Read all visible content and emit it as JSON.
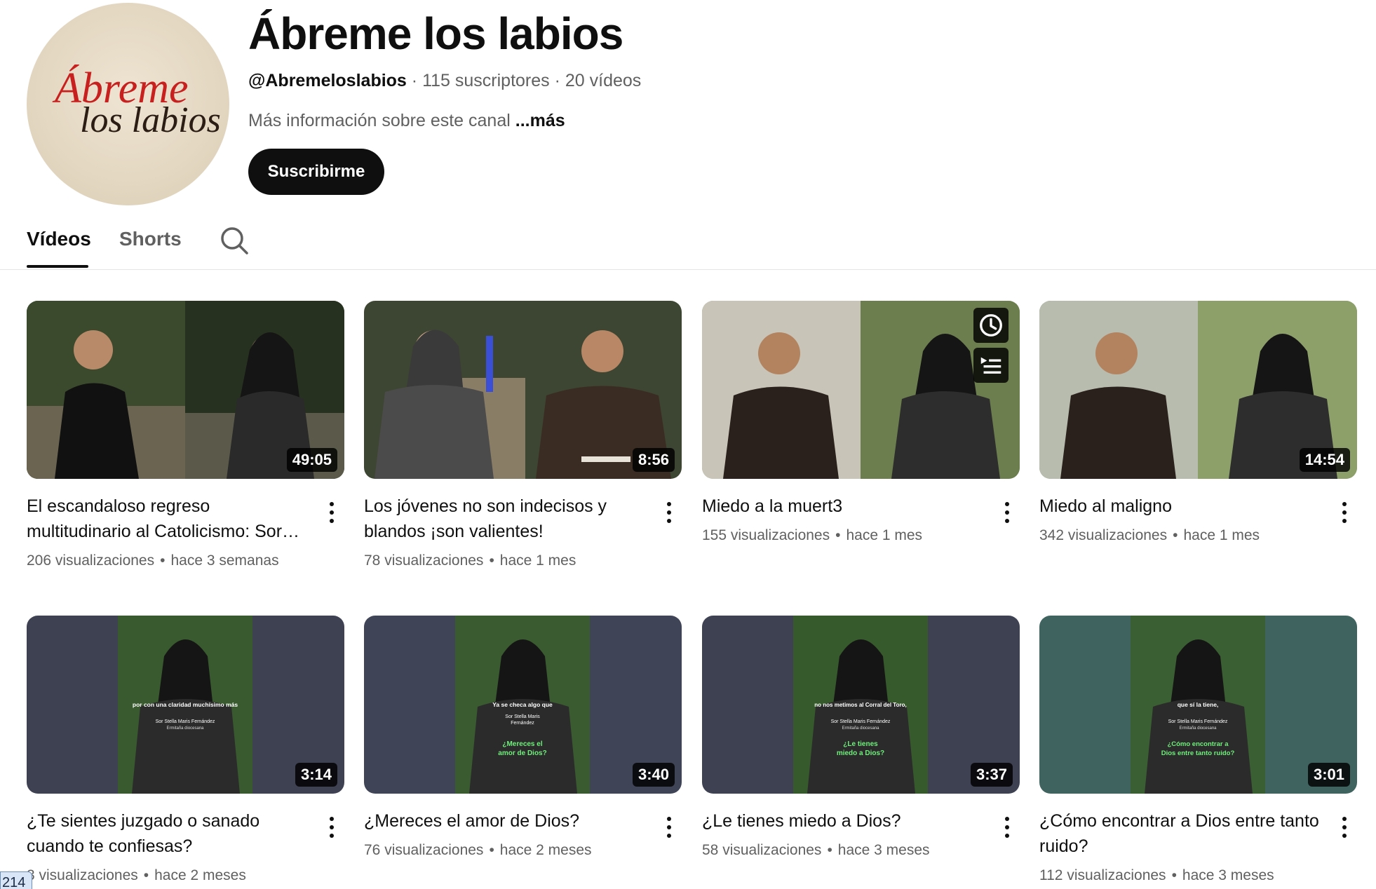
{
  "channel": {
    "avatar_text_1": "Ábreme",
    "avatar_text_2": "los labios",
    "name": "Ábreme los labios",
    "handle": "@Abremeloslabios",
    "subscribers": "115 suscriptores",
    "videos_count": "20 vídeos",
    "separator": "·",
    "about": "Más información sobre este canal",
    "about_more": "...más",
    "subscribe_label": "Suscribirme"
  },
  "tabs": {
    "videos": "Vídeos",
    "shorts": "Shorts",
    "search_icon": "search-icon"
  },
  "videos": [
    {
      "title": "El escandaloso regreso multitudinario al Catolicismo: Sor…",
      "views": "206 visualizaciones",
      "age": "hace 3 semanas",
      "duration": "49:05"
    },
    {
      "title": "Los jóvenes no son indecisos y blandos ¡son valientes!",
      "views": "78 visualizaciones",
      "age": "hace 1 mes",
      "duration": "8:56"
    },
    {
      "title": "Miedo a la muert3",
      "views": "155 visualizaciones",
      "age": "hace 1 mes",
      "duration": ""
    },
    {
      "title": "Miedo al maligno",
      "views": "342 visualizaciones",
      "age": "hace 1 mes",
      "duration": "14:54"
    },
    {
      "title": "¿Te sientes juzgado o sanado cuando te confiesas?",
      "views": "3 visualizaciones",
      "age": "hace 2 meses",
      "duration": "3:14",
      "caption_top": "por con una claridad muchísimo más",
      "caption_sub1": "Sor Stella Maris Fernández",
      "caption_sub2": "Ermitaña diocesana"
    },
    {
      "title": "¿Mereces el amor de Dios?",
      "views": "76 visualizaciones",
      "age": "hace 2 meses",
      "duration": "3:40",
      "caption_top": "Ya se checa algo que",
      "caption_sub1": "Sor Stella Maris",
      "caption_sub2": "Fernández",
      "caption_q1": "¿Mereces el",
      "caption_q2": "amor de Dios?"
    },
    {
      "title": "¿Le tienes miedo a Dios?",
      "views": "58 visualizaciones",
      "age": "hace 3 meses",
      "duration": "3:37",
      "caption_top": "no nos metimos al Corral del Toro,",
      "caption_sub1": "Sor Stella Maris Fernández",
      "caption_sub2": "Ermitaña diocesana",
      "caption_q1": "¿Le tienes",
      "caption_q2": "miedo a Dios?"
    },
    {
      "title": "¿Cómo encontrar a Dios entre tanto ruido?",
      "views": "112 visualizaciones",
      "age": "hace 3 meses",
      "duration": "3:01",
      "caption_top": "que sí la tiene,",
      "caption_sub1": "Sor Stella Maris Fernández",
      "caption_sub2": "Ermitaña diocesana",
      "caption_q1": "¿Cómo encontrar a",
      "caption_q2": "Dios entre tanto ruido?"
    }
  ],
  "overlay_icons": {
    "watch_later": "clock-icon",
    "add_queue": "queue-icon"
  },
  "corner_chip": "214",
  "colors": {
    "accent": "#0f0f0f",
    "meta": "#606060",
    "avatar_red": "#c8201e",
    "caption_green": "#6ef07a"
  }
}
